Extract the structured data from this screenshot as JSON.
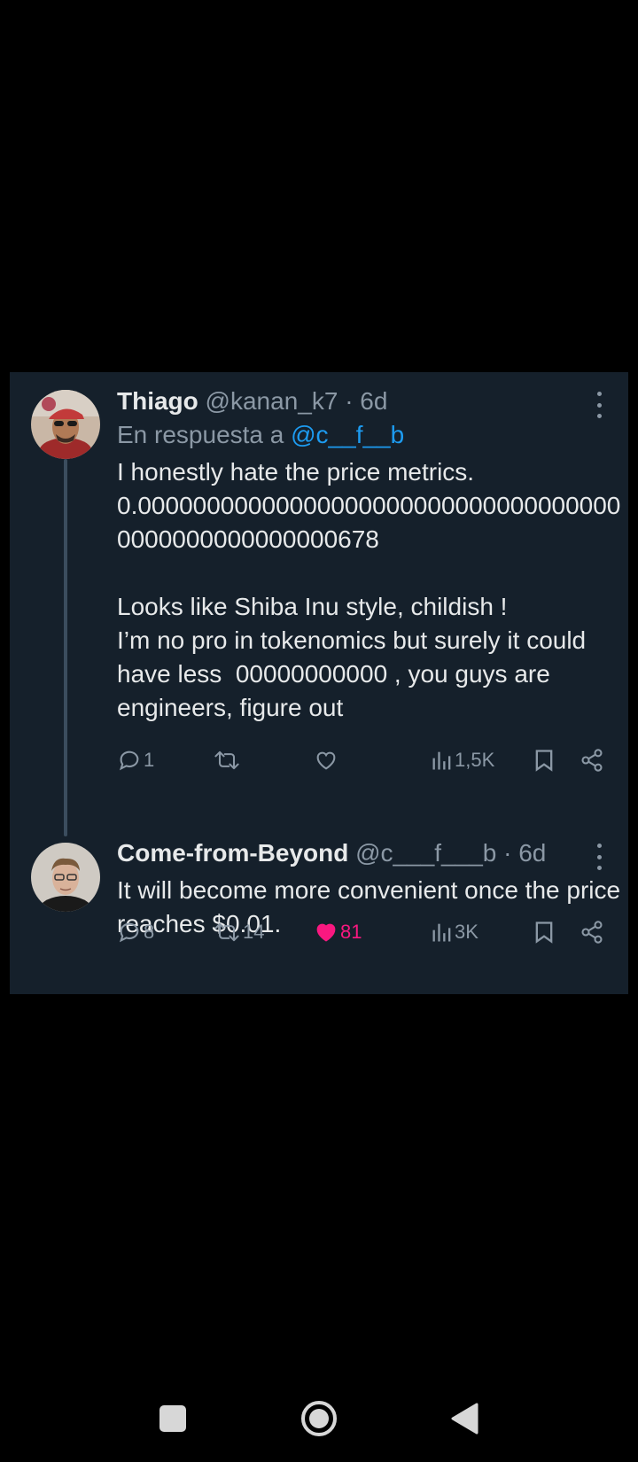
{
  "thread": {
    "tweets": [
      {
        "display_name": "Thiago",
        "handle": "@kanan_k7",
        "time": "6d",
        "reply_prefix": "En respuesta a",
        "reply_handle": "@c__f__b",
        "text_lines": [
          "I honestly hate the price metrics.",
          "0.000000000000000000000000000000000000000000000000000678",
          "Looks like Shiba Inu style, childish !",
          "I’m no pro in tokenomics but surely it could have less  00000000000 , you guys are engineers, figure out"
        ],
        "stats": {
          "replies": "1",
          "retweets": "",
          "likes": "",
          "views": "1,5K"
        }
      },
      {
        "display_name": "Come-from-Beyond",
        "handle": "@c___f___b",
        "time": "6d",
        "text": "It will become more convenient once the price reaches $0.01.",
        "stats": {
          "replies": "8",
          "retweets": "14",
          "likes": "81",
          "views": "3K"
        }
      }
    ]
  },
  "icons": {
    "reply": "reply-icon",
    "retweet": "retweet-icon",
    "like": "heart-icon",
    "views": "views-icon",
    "bookmark": "bookmark-icon",
    "share": "share-icon",
    "more": "more-icon"
  },
  "colors": {
    "background": "#000000",
    "card": "#15202b",
    "text": "#e7e9ea",
    "muted": "#8b98a5",
    "link": "#1d9bf0",
    "like_active": "#f91880"
  },
  "nav": {
    "buttons": [
      "recents-button",
      "home-button",
      "back-button"
    ]
  }
}
